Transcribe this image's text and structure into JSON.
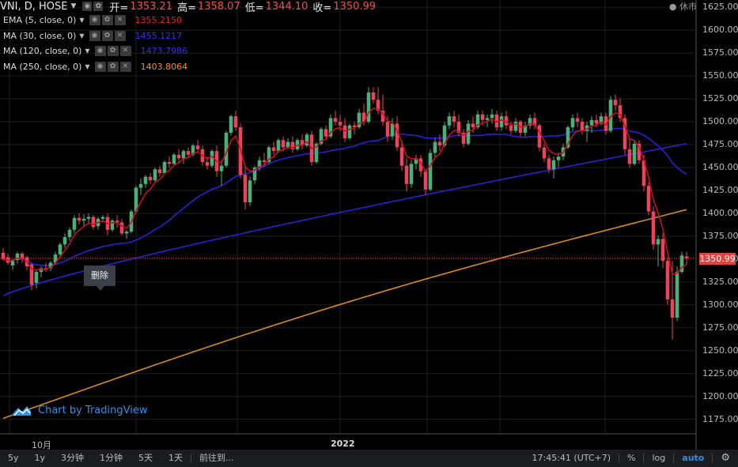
{
  "header": {
    "symbol": "VNI, D, HOSE",
    "open_label": "开=",
    "open_value": "1353.21",
    "high_label": "高=",
    "high_value": "1358.07",
    "low_label": "低=",
    "low_value": "1344.10",
    "close_label": "收=",
    "close_value": "1350.99",
    "market_status": "● 休市"
  },
  "indicators": [
    {
      "label": "EMA (5, close, 0)",
      "value": "1355.2150",
      "color": "#e8231e"
    },
    {
      "label": "MA (30, close, 0)",
      "value": "1455.1217",
      "color": "#2e1fd6"
    },
    {
      "label": "MA (120, close, 0)",
      "value": "1473.7986",
      "color": "#2e1fd6"
    },
    {
      "label": "MA (250, close, 0)",
      "value": "1403.8064",
      "color": "#f7931a"
    }
  ],
  "price_axis": [
    "1625.00",
    "1600.00",
    "1575.00",
    "1550.00",
    "1525.00",
    "1500.00",
    "1475.00",
    "1450.00",
    "1425.00",
    "1400.00",
    "1375.00",
    "1350.00",
    "1325.00",
    "1300.00",
    "1275.00",
    "1250.00",
    "1225.00",
    "1200.00",
    "1175.00"
  ],
  "current_price_label": "1350.99",
  "time_axis": [
    "10月",
    "2022"
  ],
  "tooltip": "删除",
  "watermark": "Chart by TradingView",
  "bottom_bar": {
    "ranges": [
      "5y",
      "1y",
      "3分钟",
      "1分钟",
      "5天",
      "1天"
    ],
    "goto": "前往到...",
    "clock": "17:45:41 (UTC+7)",
    "percent": "%",
    "log": "log",
    "auto": "auto",
    "settings_icon": "gear-icon"
  },
  "colors": {
    "up": "#4caf7a",
    "down": "#e8455a",
    "ema": "#c8101a",
    "ma30": "#2e1fd6",
    "ma250": "#d98a1c"
  },
  "chart_data": {
    "type": "candlestick",
    "y_range": [
      1160,
      1633
    ],
    "candles": [
      [
        1357,
        1362,
        1348,
        1350
      ],
      [
        1352,
        1356,
        1344,
        1346
      ],
      [
        1343,
        1350,
        1338,
        1348
      ],
      [
        1349,
        1358,
        1345,
        1356
      ],
      [
        1356,
        1358,
        1346,
        1350
      ],
      [
        1352,
        1354,
        1338,
        1342
      ],
      [
        1344,
        1346,
        1316,
        1322
      ],
      [
        1324,
        1338,
        1318,
        1336
      ],
      [
        1336,
        1342,
        1330,
        1340
      ],
      [
        1340,
        1346,
        1336,
        1338
      ],
      [
        1340,
        1348,
        1337,
        1346
      ],
      [
        1346,
        1358,
        1344,
        1355
      ],
      [
        1355,
        1368,
        1352,
        1366
      ],
      [
        1366,
        1378,
        1362,
        1374
      ],
      [
        1374,
        1385,
        1370,
        1382
      ],
      [
        1382,
        1398,
        1378,
        1395
      ],
      [
        1395,
        1400,
        1388,
        1392
      ],
      [
        1392,
        1399,
        1386,
        1394
      ],
      [
        1394,
        1400,
        1388,
        1396
      ],
      [
        1396,
        1398,
        1382,
        1385
      ],
      [
        1386,
        1396,
        1382,
        1394
      ],
      [
        1394,
        1398,
        1390,
        1396
      ],
      [
        1396,
        1400,
        1376,
        1382
      ],
      [
        1382,
        1394,
        1380,
        1392
      ],
      [
        1392,
        1398,
        1384,
        1390
      ],
      [
        1390,
        1394,
        1376,
        1378
      ],
      [
        1378,
        1382,
        1372,
        1380
      ],
      [
        1380,
        1404,
        1378,
        1402
      ],
      [
        1402,
        1430,
        1400,
        1428
      ],
      [
        1428,
        1438,
        1420,
        1432
      ],
      [
        1432,
        1442,
        1428,
        1440
      ],
      [
        1440,
        1444,
        1432,
        1436
      ],
      [
        1436,
        1450,
        1434,
        1448
      ],
      [
        1448,
        1452,
        1440,
        1444
      ],
      [
        1444,
        1458,
        1442,
        1456
      ],
      [
        1456,
        1462,
        1450,
        1454
      ],
      [
        1454,
        1466,
        1452,
        1464
      ],
      [
        1464,
        1470,
        1456,
        1460
      ],
      [
        1460,
        1470,
        1454,
        1468
      ],
      [
        1468,
        1472,
        1460,
        1464
      ],
      [
        1464,
        1476,
        1462,
        1474
      ],
      [
        1474,
        1480,
        1466,
        1470
      ],
      [
        1470,
        1474,
        1452,
        1456
      ],
      [
        1456,
        1462,
        1448,
        1452
      ],
      [
        1452,
        1470,
        1450,
        1468
      ],
      [
        1468,
        1474,
        1440,
        1446
      ],
      [
        1446,
        1458,
        1430,
        1452
      ],
      [
        1452,
        1490,
        1450,
        1488
      ],
      [
        1488,
        1508,
        1485,
        1506
      ],
      [
        1506,
        1512,
        1490,
        1494
      ],
      [
        1494,
        1498,
        1438,
        1442
      ],
      [
        1442,
        1450,
        1404,
        1412
      ],
      [
        1412,
        1440,
        1408,
        1436
      ],
      [
        1436,
        1452,
        1432,
        1450
      ],
      [
        1450,
        1462,
        1446,
        1458
      ],
      [
        1458,
        1466,
        1452,
        1456
      ],
      [
        1456,
        1474,
        1454,
        1472
      ],
      [
        1472,
        1478,
        1464,
        1468
      ],
      [
        1468,
        1482,
        1466,
        1480
      ],
      [
        1480,
        1484,
        1468,
        1472
      ],
      [
        1472,
        1482,
        1470,
        1478
      ],
      [
        1478,
        1484,
        1466,
        1470
      ],
      [
        1470,
        1482,
        1468,
        1480
      ],
      [
        1480,
        1486,
        1470,
        1474
      ],
      [
        1474,
        1488,
        1472,
        1486
      ],
      [
        1486,
        1490,
        1452,
        1456
      ],
      [
        1456,
        1478,
        1454,
        1476
      ],
      [
        1476,
        1494,
        1474,
        1492
      ],
      [
        1492,
        1496,
        1480,
        1484
      ],
      [
        1484,
        1508,
        1482,
        1504
      ],
      [
        1504,
        1512,
        1496,
        1500
      ],
      [
        1500,
        1508,
        1490,
        1496
      ],
      [
        1496,
        1504,
        1478,
        1482
      ],
      [
        1482,
        1498,
        1480,
        1496
      ],
      [
        1496,
        1500,
        1486,
        1494
      ],
      [
        1494,
        1514,
        1492,
        1510
      ],
      [
        1510,
        1520,
        1496,
        1500
      ],
      [
        1500,
        1538,
        1498,
        1532
      ],
      [
        1532,
        1538,
        1520,
        1524
      ],
      [
        1524,
        1538,
        1508,
        1512
      ],
      [
        1512,
        1530,
        1496,
        1500
      ],
      [
        1500,
        1506,
        1478,
        1484
      ],
      [
        1484,
        1504,
        1480,
        1498
      ],
      [
        1498,
        1506,
        1468,
        1472
      ],
      [
        1472,
        1480,
        1446,
        1452
      ],
      [
        1452,
        1460,
        1424,
        1432
      ],
      [
        1432,
        1458,
        1428,
        1454
      ],
      [
        1454,
        1464,
        1448,
        1460
      ],
      [
        1460,
        1464,
        1440,
        1446
      ],
      [
        1446,
        1448,
        1420,
        1426
      ],
      [
        1426,
        1470,
        1424,
        1466
      ],
      [
        1466,
        1482,
        1462,
        1478
      ],
      [
        1478,
        1486,
        1468,
        1474
      ],
      [
        1474,
        1500,
        1472,
        1496
      ],
      [
        1496,
        1510,
        1492,
        1506
      ],
      [
        1506,
        1512,
        1494,
        1500
      ],
      [
        1500,
        1508,
        1484,
        1488
      ],
      [
        1488,
        1492,
        1472,
        1476
      ],
      [
        1476,
        1502,
        1474,
        1498
      ],
      [
        1498,
        1506,
        1488,
        1494
      ],
      [
        1494,
        1512,
        1492,
        1508
      ],
      [
        1508,
        1512,
        1496,
        1502
      ],
      [
        1502,
        1508,
        1494,
        1504
      ],
      [
        1504,
        1514,
        1498,
        1508
      ],
      [
        1508,
        1512,
        1490,
        1494
      ],
      [
        1494,
        1510,
        1490,
        1506
      ],
      [
        1506,
        1512,
        1492,
        1496
      ],
      [
        1496,
        1500,
        1486,
        1490
      ],
      [
        1490,
        1504,
        1488,
        1500
      ],
      [
        1500,
        1502,
        1484,
        1488
      ],
      [
        1488,
        1500,
        1484,
        1496
      ],
      [
        1496,
        1508,
        1492,
        1504
      ],
      [
        1504,
        1510,
        1492,
        1496
      ],
      [
        1496,
        1498,
        1468,
        1472
      ],
      [
        1472,
        1476,
        1456,
        1460
      ],
      [
        1460,
        1464,
        1444,
        1448
      ],
      [
        1448,
        1462,
        1438,
        1458
      ],
      [
        1458,
        1466,
        1450,
        1462
      ],
      [
        1462,
        1476,
        1458,
        1472
      ],
      [
        1472,
        1496,
        1470,
        1494
      ],
      [
        1494,
        1508,
        1490,
        1504
      ],
      [
        1504,
        1510,
        1494,
        1500
      ],
      [
        1500,
        1504,
        1486,
        1490
      ],
      [
        1490,
        1500,
        1478,
        1496
      ],
      [
        1496,
        1506,
        1488,
        1502
      ],
      [
        1502,
        1508,
        1494,
        1498
      ],
      [
        1498,
        1510,
        1496,
        1506
      ],
      [
        1506,
        1510,
        1486,
        1490
      ],
      [
        1490,
        1528,
        1488,
        1524
      ],
      [
        1524,
        1530,
        1512,
        1518
      ],
      [
        1518,
        1526,
        1500,
        1504
      ],
      [
        1504,
        1508,
        1464,
        1470
      ],
      [
        1470,
        1482,
        1450,
        1454
      ],
      [
        1454,
        1480,
        1452,
        1476
      ],
      [
        1476,
        1480,
        1454,
        1458
      ],
      [
        1458,
        1464,
        1424,
        1430
      ],
      [
        1430,
        1434,
        1398,
        1402
      ],
      [
        1402,
        1408,
        1360,
        1366
      ],
      [
        1366,
        1376,
        1342,
        1372
      ],
      [
        1372,
        1378,
        1340,
        1348
      ],
      [
        1348,
        1352,
        1300,
        1306
      ],
      [
        1306,
        1348,
        1262,
        1286
      ],
      [
        1286,
        1342,
        1282,
        1336
      ],
      [
        1336,
        1358,
        1334,
        1354
      ],
      [
        1353,
        1358,
        1344,
        1351
      ]
    ]
  }
}
